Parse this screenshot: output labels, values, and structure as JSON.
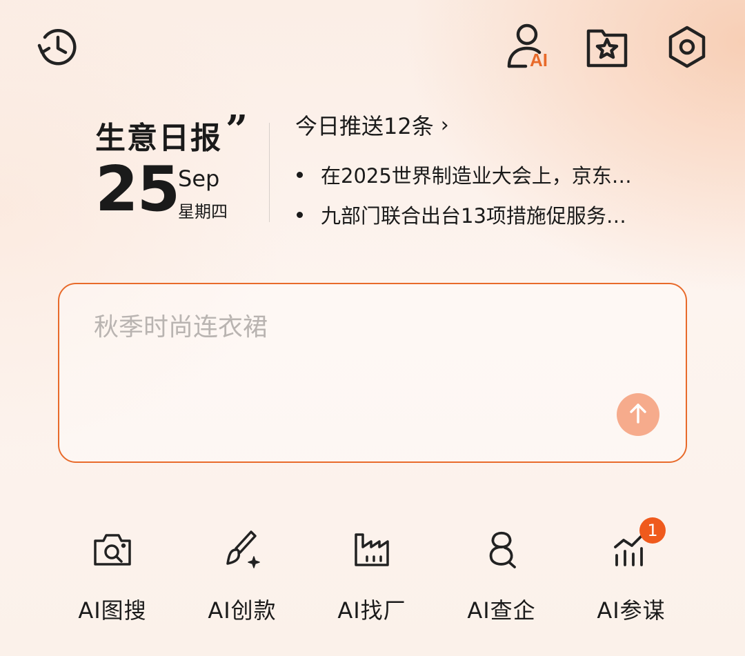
{
  "header": {
    "icons": [
      "history-icon",
      "ai-profile-icon",
      "favorites-folder-icon",
      "settings-icon"
    ],
    "ai_badge_text": "AI",
    "accent_color": "#E86A2A"
  },
  "report": {
    "title": "生意日报",
    "quote_mark": "”",
    "day": "25",
    "month": "Sep",
    "weekday": "星期四",
    "push_header": "今日推送12条",
    "push_chevron": "›",
    "news": [
      "在2025世界制造业大会上，京东…",
      "九部门联合出台13项措施促服务…"
    ]
  },
  "input": {
    "placeholder": "秋季时尚连衣裙",
    "value": "",
    "send_icon": "arrow-up-icon"
  },
  "tools": [
    {
      "label": "AI图搜",
      "icon": "camera-search-icon"
    },
    {
      "label": "AI创款",
      "icon": "brush-sparkle-icon"
    },
    {
      "label": "AI找厂",
      "icon": "factory-icon"
    },
    {
      "label": "AI查企",
      "icon": "company-search-icon"
    },
    {
      "label": "AI参谋",
      "icon": "chart-bars-icon",
      "badge": "1"
    }
  ]
}
